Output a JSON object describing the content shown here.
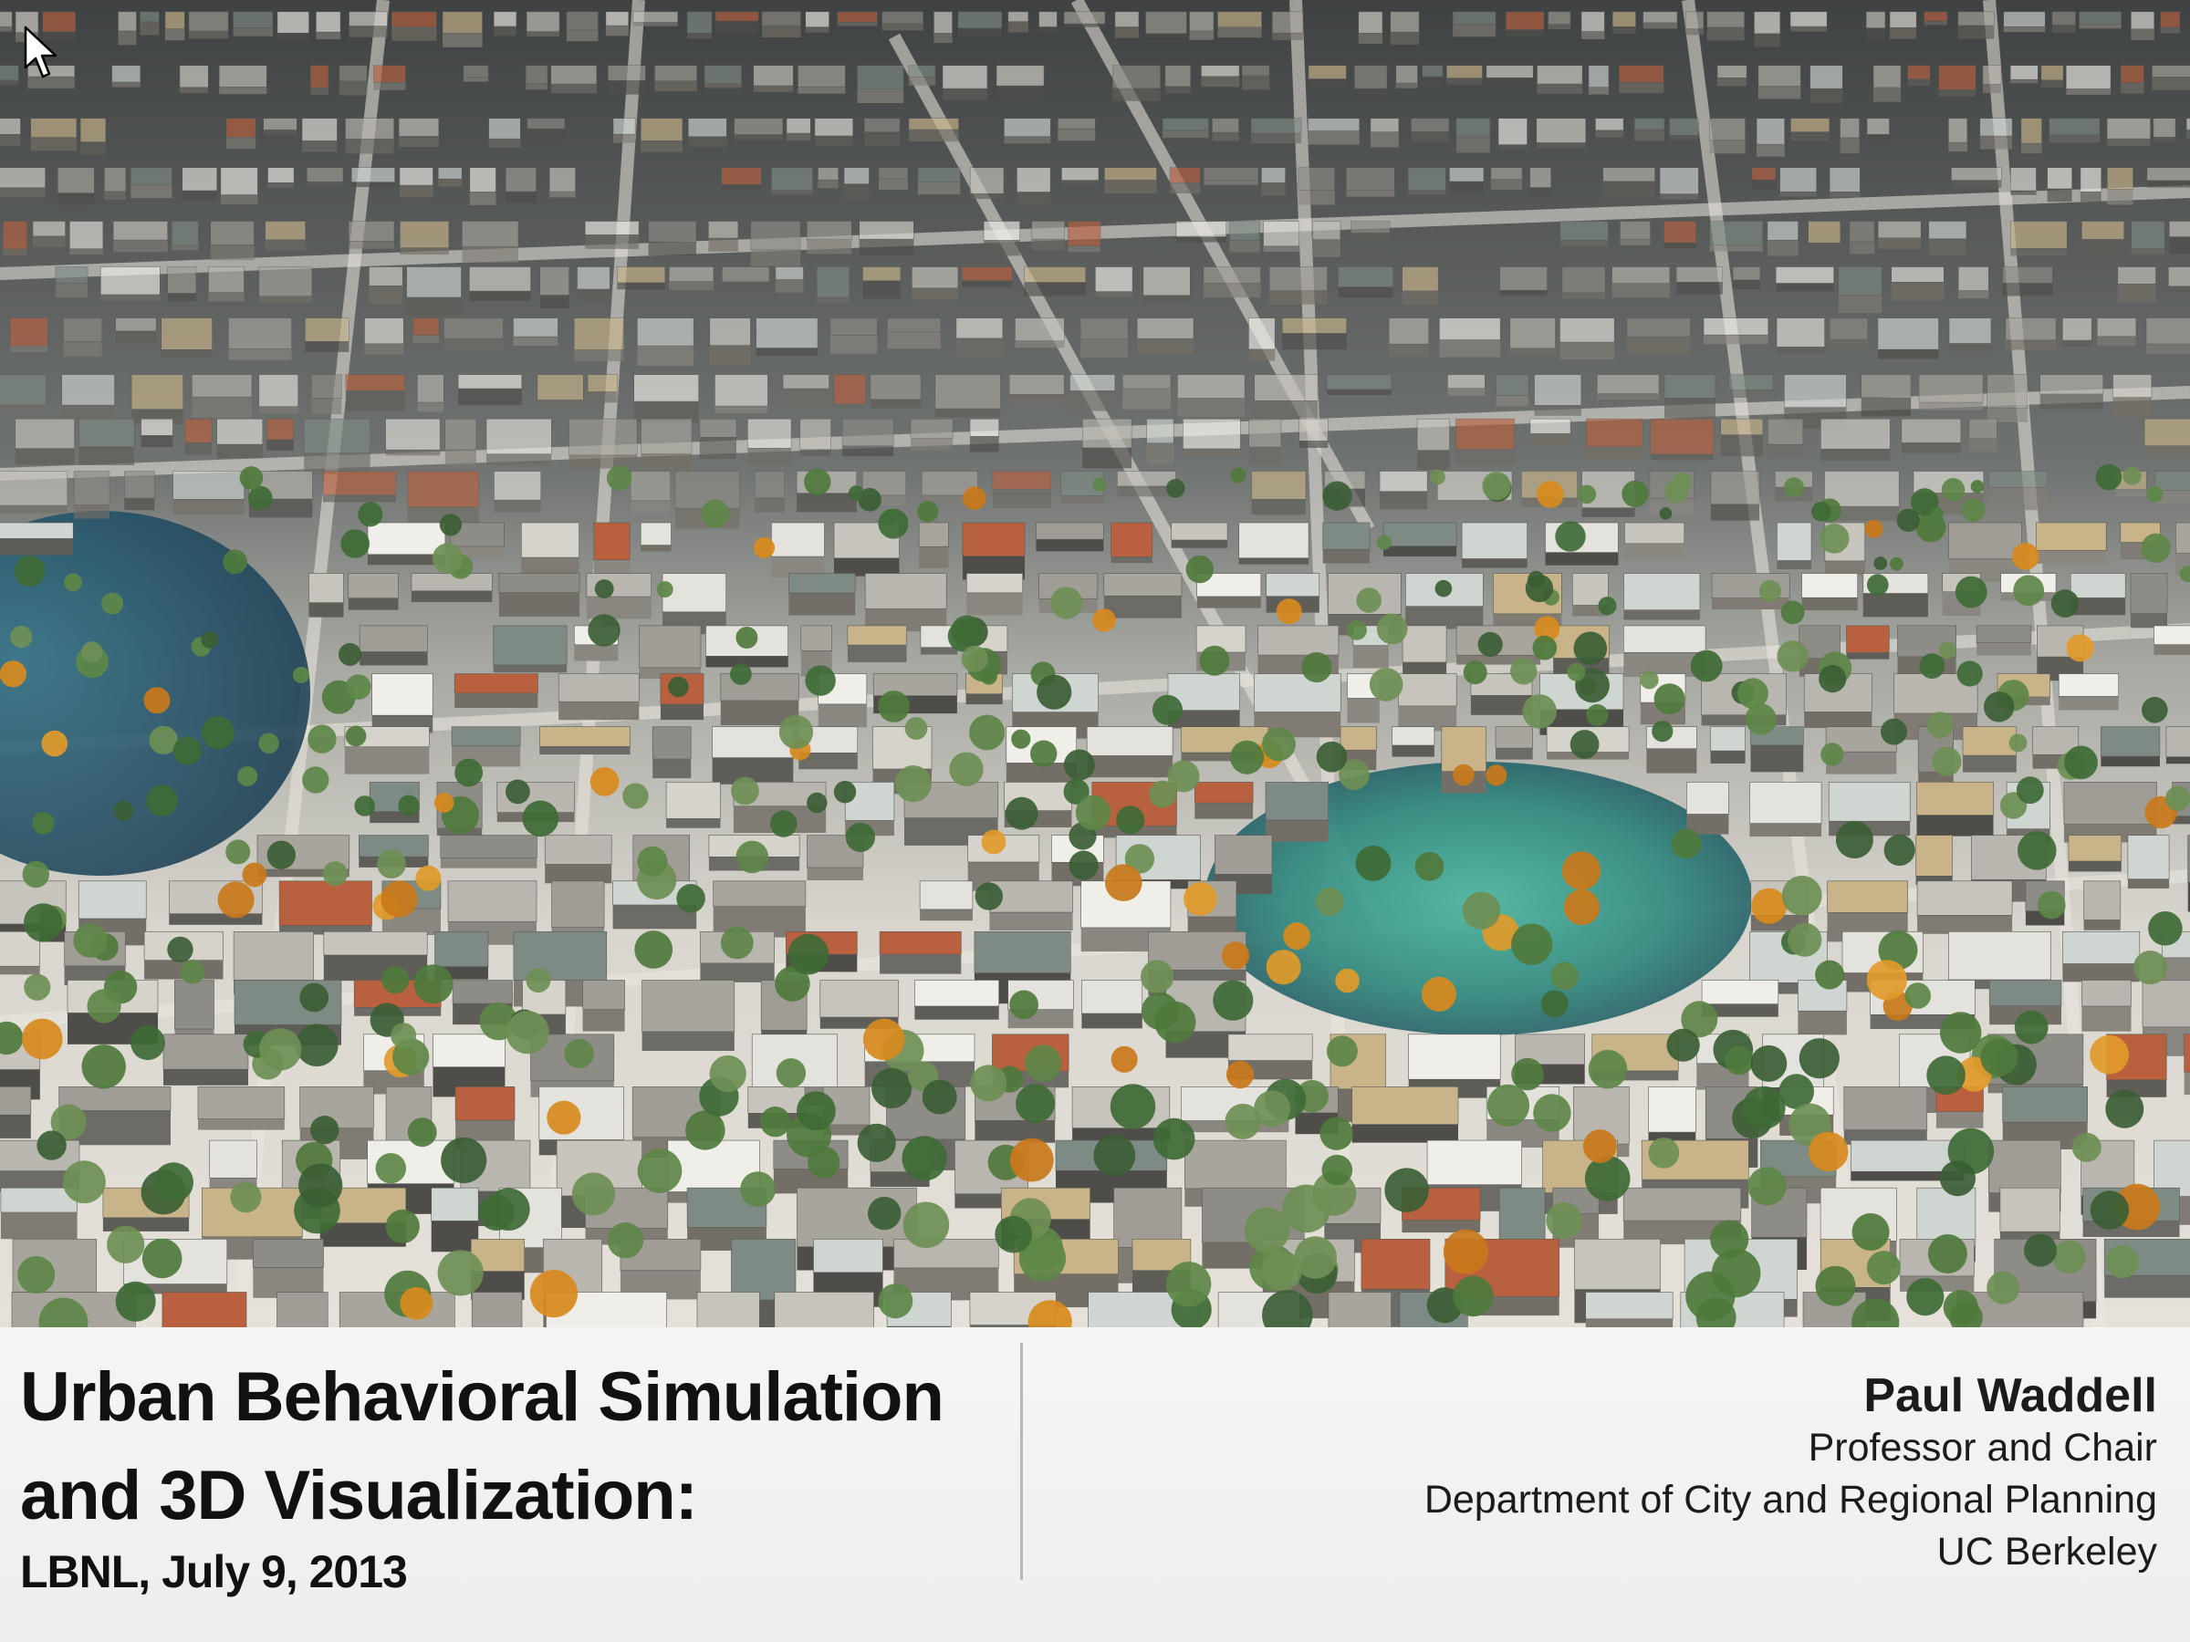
{
  "slide": {
    "title_line_1": "Urban Behavioral Simulation",
    "title_line_2": "and 3D Visualization:",
    "event_line": "LBNL, July 9, 2013",
    "presenter": {
      "name": "Paul Waddell",
      "role": "Professor and Chair",
      "department": "Department of City and Regional Planning",
      "organization": "UC Berkeley"
    }
  },
  "icons": {
    "pointer": "mouse-pointer-icon"
  },
  "colors": {
    "title_text": "#111111",
    "credit_text": "#1b1b1b",
    "caption_background": "#f3f3f2",
    "divider": "#b9b9b9",
    "tree_green": "#4f7a3c",
    "tree_orange": "#d88a1d",
    "park_teal": "#2a9a8a"
  }
}
